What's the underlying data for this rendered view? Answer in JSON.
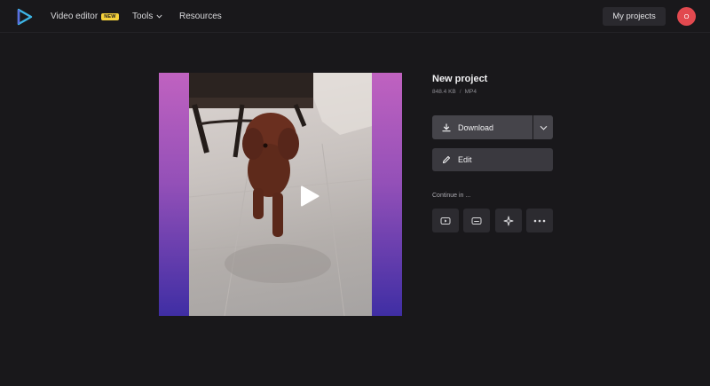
{
  "header": {
    "logo_icon": "clipchamp-play-logo",
    "nav": {
      "video_editor": "Video editor",
      "new_badge": "NEW",
      "tools": "Tools",
      "resources": "Resources"
    },
    "my_projects": "My projects",
    "avatar_initial": "O"
  },
  "project": {
    "title": "New project",
    "size": "848.4 KB",
    "separator": "/",
    "format": "MP4"
  },
  "actions": {
    "download_label": "Download",
    "edit_label": "Edit"
  },
  "continue": {
    "label": "Continue in ...",
    "tiles": [
      "youtube-icon",
      "subtitles-icon",
      "sparkle-icon",
      "more-icon"
    ]
  },
  "colors": {
    "background": "#19181b",
    "accent_logo": "#3db5e6",
    "badge": "#f5d13b",
    "avatar": "#e2494f",
    "button": "#45444a",
    "tile": "#2c2b30"
  }
}
